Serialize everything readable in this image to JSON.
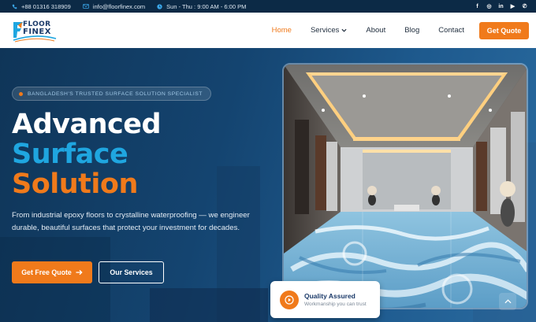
{
  "topbar": {
    "phone": "+88 01316 318909",
    "email": "info@floorfinex.com",
    "hours": "Sun - Thu : 9:00 AM - 6:00 PM",
    "social": [
      "facebook-icon",
      "instagram-icon",
      "linkedin-icon",
      "youtube-icon",
      "whatsapp-icon"
    ],
    "social_glyphs": [
      "f",
      "◎",
      "in",
      "▶",
      "✆"
    ]
  },
  "header": {
    "logo_line1": "FLOOR",
    "logo_line2": "FINEX",
    "nav": {
      "home": "Home",
      "services": "Services",
      "about": "About",
      "blog": "Blog",
      "contact": "Contact"
    },
    "cta": "Get Quote"
  },
  "hero": {
    "badge": "BANGLADESH'S TRUSTED SURFACE SOLUTION SPECIALIST",
    "title_line1": "Advanced",
    "title_line2": "Surface",
    "title_line3": "Solution",
    "description": "From industrial epoxy floors to crystalline waterproofing — we engineer durable, beautiful surfaces that protect your investment for decades.",
    "primary_button": "Get Free Quote",
    "secondary_button": "Our Services"
  },
  "quality_card": {
    "title": "Quality Assured",
    "subtitle": "Workmanship you can trust"
  },
  "colors": {
    "accent": "#f07a1b",
    "brand_blue": "#1fa6e0",
    "navy": "#0e3256"
  }
}
